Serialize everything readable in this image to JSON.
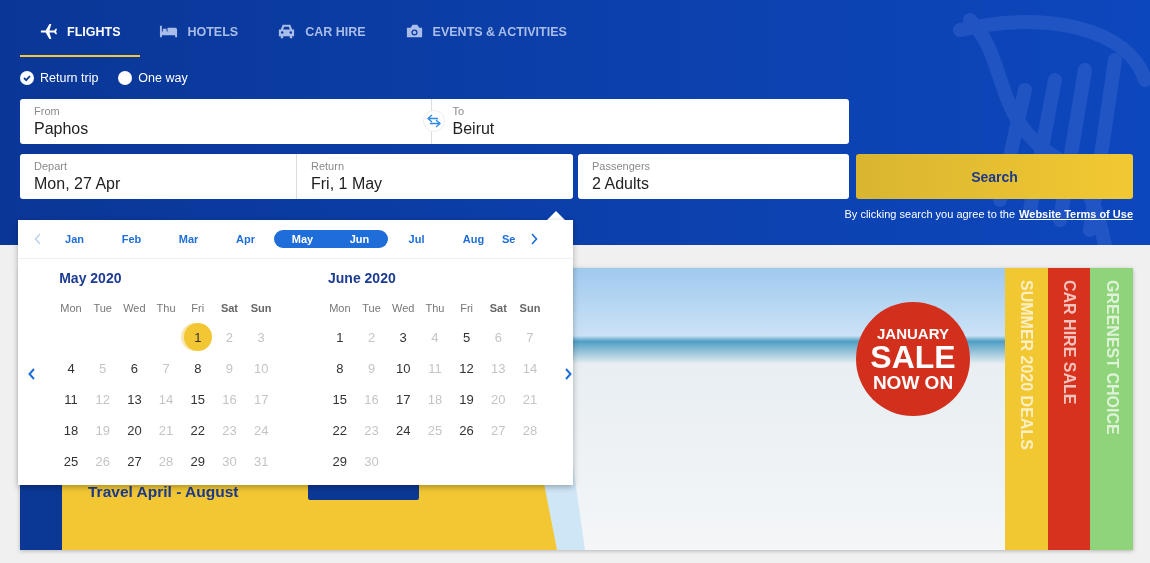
{
  "nav_tabs": [
    {
      "label": "FLIGHTS",
      "selected": true
    },
    {
      "label": "HOTELS",
      "selected": false
    },
    {
      "label": "CAR HIRE",
      "selected": false
    },
    {
      "label": "EVENTS & ACTIVITIES",
      "selected": false
    }
  ],
  "trip_types": [
    {
      "label": "Return trip",
      "selected": true
    },
    {
      "label": "One way",
      "selected": false
    }
  ],
  "route": {
    "from": {
      "label": "From",
      "value": "Paphos"
    },
    "to": {
      "label": "To",
      "value": "Beirut"
    }
  },
  "dates": {
    "depart": {
      "label": "Depart",
      "value": "Mon, 27 Apr"
    },
    "return": {
      "label": "Return",
      "value": "Fri, 1 May"
    }
  },
  "passengers": {
    "label": "Passengers",
    "value": "2 Adults"
  },
  "search_button": "Search",
  "terms": {
    "text": "By clicking search you agree to the",
    "link": "Website Terms of Use"
  },
  "calendar": {
    "prev_enabled": false,
    "month_strip": [
      {
        "label": "Jan",
        "selected": false
      },
      {
        "label": "Feb",
        "selected": false
      },
      {
        "label": "Mar",
        "selected": false
      },
      {
        "label": "Apr",
        "selected": false
      },
      {
        "label": "May",
        "selected": true
      },
      {
        "label": "Jun",
        "selected": true
      },
      {
        "label": "Jul",
        "selected": false
      },
      {
        "label": "Aug",
        "selected": false
      },
      {
        "label": "Se",
        "selected": false
      }
    ],
    "months": [
      {
        "title": "May 2020",
        "weekdays": [
          {
            "label": "Mon",
            "weekend": false
          },
          {
            "label": "Tue",
            "weekend": false
          },
          {
            "label": "Wed",
            "weekend": false
          },
          {
            "label": "Thu",
            "weekend": false
          },
          {
            "label": "Fri",
            "weekend": false
          },
          {
            "label": "Sat",
            "weekend": true
          },
          {
            "label": "Sun",
            "weekend": true
          }
        ],
        "weeks": [
          {
            "days": [
              {
                "day": "1",
                "available": true,
                "selected": true
              },
              {
                "day": "2",
                "available": false,
                "selected": false
              },
              {
                "day": "3",
                "available": false,
                "selected": false
              }
            ]
          },
          {
            "days": [
              {
                "day": "4",
                "available": true,
                "selected": false
              },
              {
                "day": "5",
                "available": false,
                "selected": false
              },
              {
                "day": "6",
                "available": true,
                "selected": false
              },
              {
                "day": "7",
                "available": false,
                "selected": false
              },
              {
                "day": "8",
                "available": true,
                "selected": false
              },
              {
                "day": "9",
                "available": false,
                "selected": false
              },
              {
                "day": "10",
                "available": false,
                "selected": false
              }
            ]
          },
          {
            "days": [
              {
                "day": "11",
                "available": true,
                "selected": false
              },
              {
                "day": "12",
                "available": false,
                "selected": false
              },
              {
                "day": "13",
                "available": true,
                "selected": false
              },
              {
                "day": "14",
                "available": false,
                "selected": false
              },
              {
                "day": "15",
                "available": true,
                "selected": false
              },
              {
                "day": "16",
                "available": false,
                "selected": false
              },
              {
                "day": "17",
                "available": false,
                "selected": false
              }
            ]
          },
          {
            "days": [
              {
                "day": "18",
                "available": true,
                "selected": false
              },
              {
                "day": "19",
                "available": false,
                "selected": false
              },
              {
                "day": "20",
                "available": true,
                "selected": false
              },
              {
                "day": "21",
                "available": false,
                "selected": false
              },
              {
                "day": "22",
                "available": true,
                "selected": false
              },
              {
                "day": "23",
                "available": false,
                "selected": false
              },
              {
                "day": "24",
                "available": false,
                "selected": false
              }
            ]
          },
          {
            "days": [
              {
                "day": "25",
                "available": true,
                "selected": false
              },
              {
                "day": "26",
                "available": false,
                "selected": false
              },
              {
                "day": "27",
                "available": true,
                "selected": false
              },
              {
                "day": "28",
                "available": false,
                "selected": false
              },
              {
                "day": "29",
                "available": true,
                "selected": false
              },
              {
                "day": "30",
                "available": false,
                "selected": false
              },
              {
                "day": "31",
                "available": false,
                "selected": false
              }
            ]
          }
        ]
      },
      {
        "title": "June 2020",
        "weekdays": [
          {
            "label": "Mon",
            "weekend": false
          },
          {
            "label": "Tue",
            "weekend": false
          },
          {
            "label": "Wed",
            "weekend": false
          },
          {
            "label": "Thu",
            "weekend": false
          },
          {
            "label": "Fri",
            "weekend": false
          },
          {
            "label": "Sat",
            "weekend": true
          },
          {
            "label": "Sun",
            "weekend": true
          }
        ],
        "weeks": [
          {
            "days": [
              {
                "day": "1",
                "available": true,
                "selected": false
              },
              {
                "day": "2",
                "available": false,
                "selected": false
              },
              {
                "day": "3",
                "available": true,
                "selected": false
              },
              {
                "day": "4",
                "available": false,
                "selected": false
              },
              {
                "day": "5",
                "available": true,
                "selected": false
              },
              {
                "day": "6",
                "available": false,
                "selected": false
              },
              {
                "day": "7",
                "available": false,
                "selected": false
              }
            ]
          },
          {
            "days": [
              {
                "day": "8",
                "available": true,
                "selected": false
              },
              {
                "day": "9",
                "available": false,
                "selected": false
              },
              {
                "day": "10",
                "available": true,
                "selected": false
              },
              {
                "day": "11",
                "available": false,
                "selected": false
              },
              {
                "day": "12",
                "available": true,
                "selected": false
              },
              {
                "day": "13",
                "available": false,
                "selected": false
              },
              {
                "day": "14",
                "available": false,
                "selected": false
              }
            ]
          },
          {
            "days": [
              {
                "day": "15",
                "available": true,
                "selected": false
              },
              {
                "day": "16",
                "available": false,
                "selected": false
              },
              {
                "day": "17",
                "available": true,
                "selected": false
              },
              {
                "day": "18",
                "available": false,
                "selected": false
              },
              {
                "day": "19",
                "available": true,
                "selected": false
              },
              {
                "day": "20",
                "available": false,
                "selected": false
              },
              {
                "day": "21",
                "available": false,
                "selected": false
              }
            ]
          },
          {
            "days": [
              {
                "day": "22",
                "available": true,
                "selected": false
              },
              {
                "day": "23",
                "available": false,
                "selected": false
              },
              {
                "day": "24",
                "available": true,
                "selected": false
              },
              {
                "day": "25",
                "available": false,
                "selected": false
              },
              {
                "day": "26",
                "available": true,
                "selected": false
              },
              {
                "day": "27",
                "available": false,
                "selected": false
              },
              {
                "day": "28",
                "available": false,
                "selected": false
              }
            ]
          },
          {
            "days": [
              {
                "day": "29",
                "available": true,
                "selected": false
              },
              {
                "day": "30",
                "available": false,
                "selected": false
              }
            ]
          }
        ]
      }
    ]
  },
  "banner": {
    "headline": "Travel April - August",
    "badge": [
      "JANUARY",
      "SALE",
      "NOW ON"
    ],
    "ribbons": [
      {
        "label": "SUMMER 2020 DEALS",
        "color": "#f2c832"
      },
      {
        "label": "CAR HIRE SALE",
        "color": "#d7321e"
      },
      {
        "label": "GREENEST CHOICE",
        "color": "#8fd47a"
      }
    ]
  }
}
